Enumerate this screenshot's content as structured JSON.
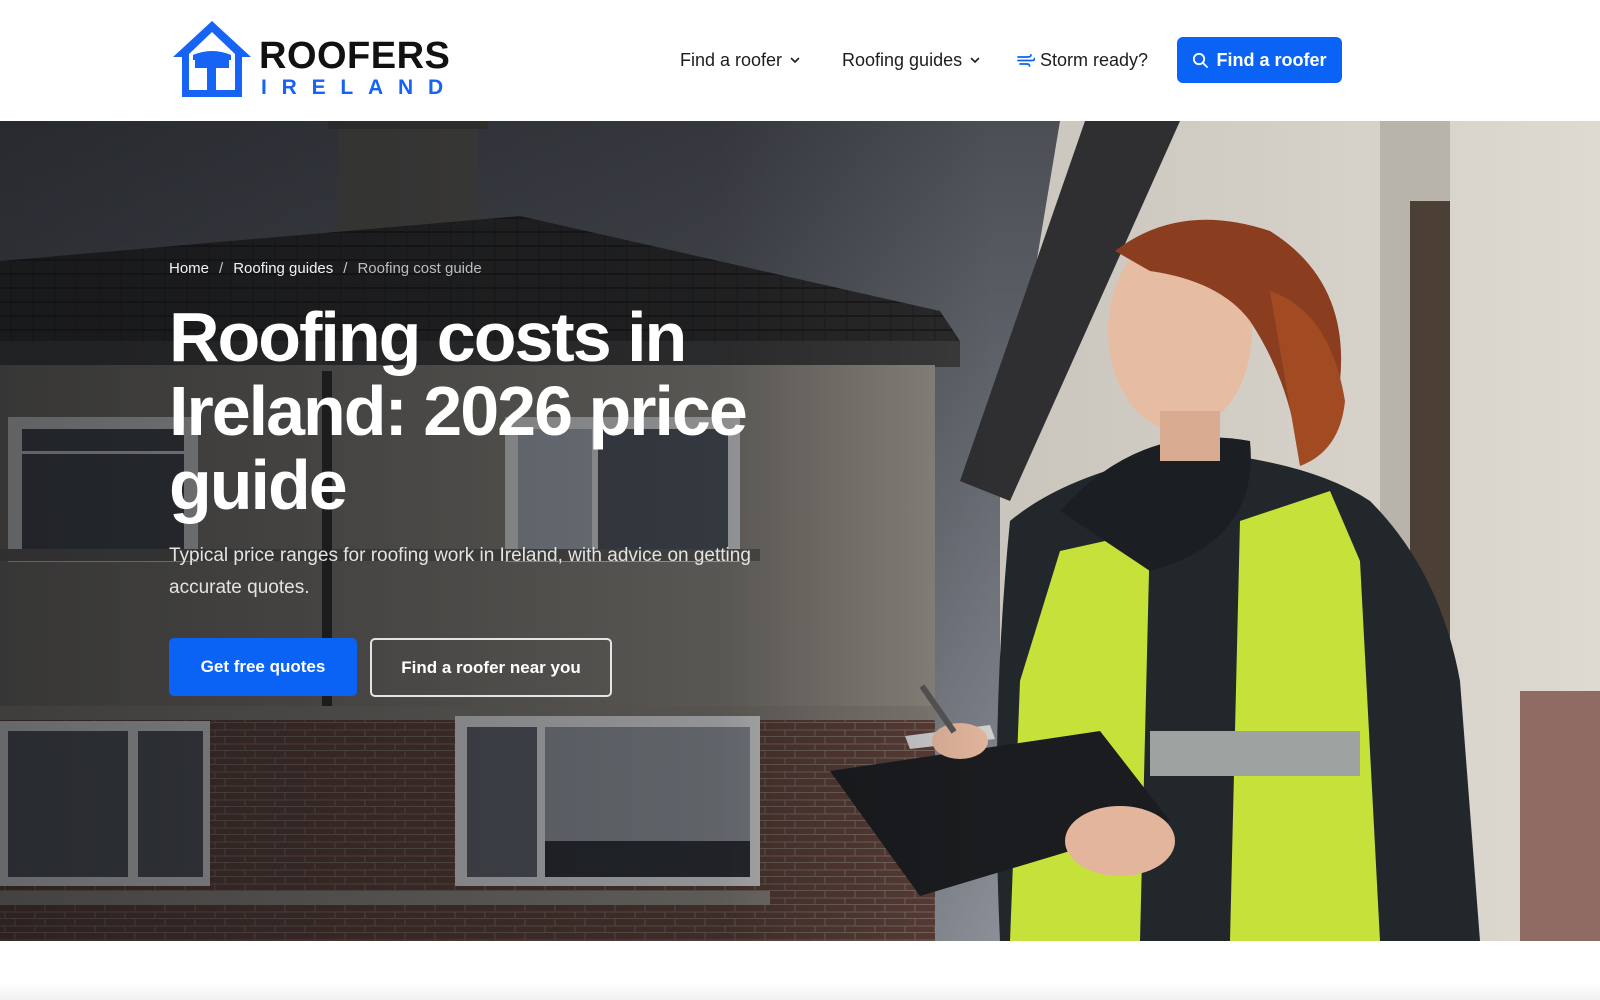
{
  "brand": {
    "name_line1": "ROOFERS",
    "name_line2": "IRELAND",
    "primary_color": "#0b63f5",
    "logo_icon": "house-hammer-icon"
  },
  "nav": {
    "items": [
      {
        "label": "Find a roofer",
        "icon": "chevron-down-icon"
      },
      {
        "label": "Roofing guides",
        "icon": "chevron-down-icon"
      },
      {
        "label": "Storm ready?",
        "icon": "wind-icon"
      }
    ],
    "cta": {
      "label": "Find a roofer",
      "icon": "search-icon"
    }
  },
  "breadcrumb": {
    "items": [
      "Home",
      "Roofing guides"
    ],
    "current": "Roofing cost guide",
    "separator": "/"
  },
  "hero": {
    "title": "Roofing costs in Ireland: 2026 price guide",
    "subtitle": "Typical price ranges for roofing work in Ireland, with advice on getting accurate quotes.",
    "primary_button": "Get free quotes",
    "secondary_button": "Find a roofer near you",
    "image": "photo-roof-inspector-woman-hi-vis-clipboard-house"
  }
}
